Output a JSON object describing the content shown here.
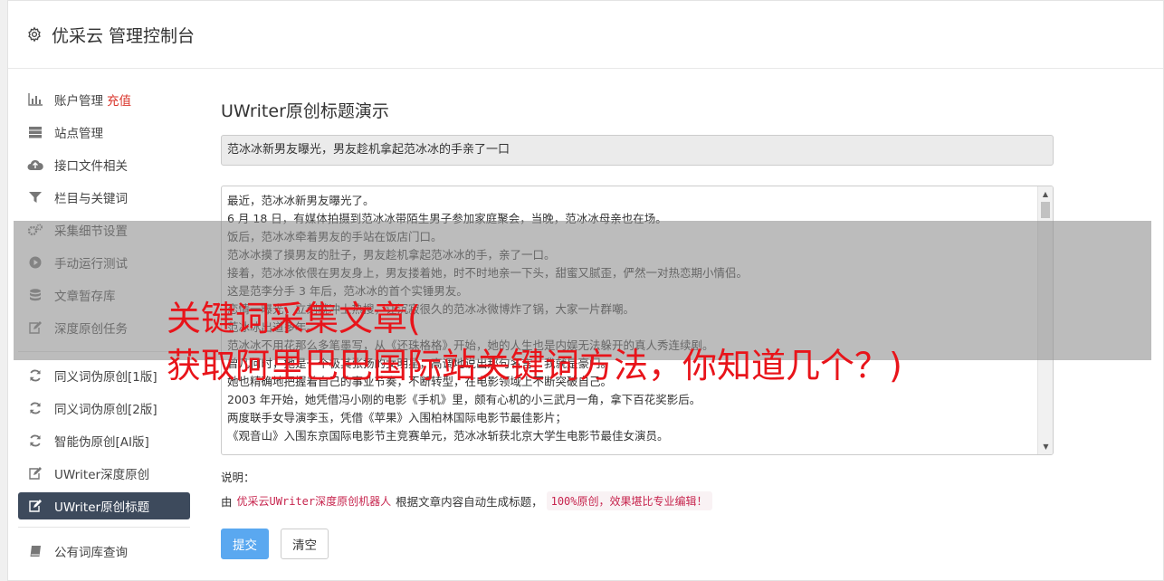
{
  "header": {
    "title": "优采云 管理控制台"
  },
  "sidebar": {
    "group1": [
      {
        "label": "账户管理",
        "extra": "充值",
        "icon": "bar-chart-icon"
      },
      {
        "label": "站点管理",
        "icon": "server-icon"
      },
      {
        "label": "接口文件相关",
        "icon": "cloud-upload-icon"
      },
      {
        "label": "栏目与关键词",
        "icon": "filter-icon"
      },
      {
        "label": "采集细节设置",
        "icon": "cogs-icon"
      },
      {
        "label": "手动运行测试",
        "icon": "play-circle-icon"
      },
      {
        "label": "文章暂存库",
        "icon": "database-icon"
      },
      {
        "label": "深度原创任务",
        "icon": "edit-icon"
      }
    ],
    "group2": [
      {
        "label": "同义词伪原创[1版]",
        "icon": "refresh-icon"
      },
      {
        "label": "同义词伪原创[2版]",
        "icon": "refresh-icon"
      },
      {
        "label": "智能伪原创[AI版]",
        "icon": "refresh-icon"
      },
      {
        "label": "UWriter深度原创",
        "icon": "edit-icon"
      },
      {
        "label": "UWriter原创标题",
        "icon": "edit-icon",
        "active": true
      }
    ],
    "group3": [
      {
        "label": "公有词库查询",
        "icon": "book-icon"
      }
    ]
  },
  "main": {
    "heading": "UWriter原创标题演示",
    "title_value": "范冰冰新男友曝光，男友趁机拿起范冰冰的手亲了一口",
    "article_lines": [
      "最近，范冰冰新男友曝光了。",
      "6 月 18 日，有媒体拍摄到范冰冰带陌生男子参加家庭聚会，当晚，范冰冰母亲也在场。",
      "饭后，范冰冰牵着男友的手站在饭店门口。",
      "范冰冰摸了摸男友的肚子，男友趁机拿起范冰冰的手，亲了一口。",
      "接着，范冰冰依偎在男友身上，男友搂着她，时不时地亲一下头，甜蜜又腻歪，俨然一对热恋期小情侣。",
      "这是范李分手 3 年后，范冰冰的首个实锤男友。",
      "恋情一曝光，立刻就冲上热搜，让沉寂很久的范冰冰微博炸了锅，大家一片群嘲。",
      "范冰冰出道多年。",
      "范冰冰不用花那么多笔墨写，从《还珠格格》开始，她的人生也是内娱无法躲开的真人秀连续剧。",
      "曾几何时，她是一个极其张扬的女明星，高调地说出那句名言：我就是豪门。",
      "她也精确地把握着自己的事业节奏，不断转型，在电影领域上不断突破自己。",
      "2003 年开始，她凭借冯小刚的电影《手机》里，颇有心机的小三武月一角，拿下百花奖影后。",
      "两度联手女导演李玉，凭借《苹果》入围柏林国际电影节最佳影片；",
      "《观音山》入围东京国际电影节主竞赛单元，范冰冰斩获北京大学生电影节最佳女演员。"
    ],
    "note_label": "说明：",
    "note_prefix": "由",
    "note_product": "优采云UWriter深度原创机器人",
    "note_middle": "根据文章内容自动生成标题，",
    "note_highlight": "100%原创，效果堪比专业编辑！",
    "submit_label": "提交",
    "clear_label": "清空"
  },
  "overlay": {
    "line1": "关键词采集文章(",
    "line2": "获取阿里巴巴国际站关键词方法，你知道几个？)"
  },
  "colors": {
    "active_bg": "#3d4a5c",
    "primary_btn": "#5aa8f0",
    "overlay_text": "#e8141a",
    "extra_red": "#d9342b"
  }
}
